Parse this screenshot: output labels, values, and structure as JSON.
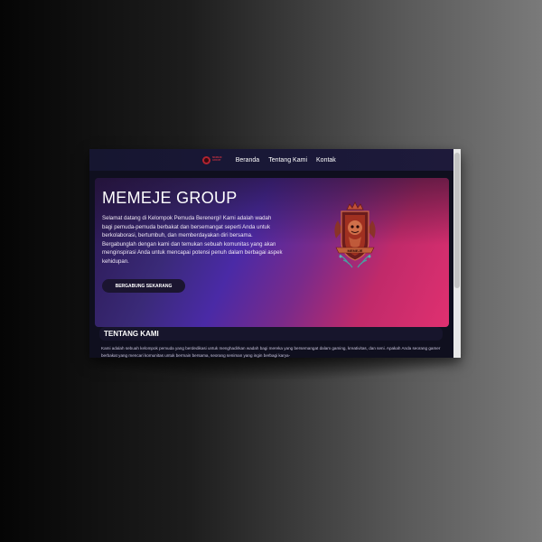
{
  "nav": {
    "logo_line1": "MEMEJE",
    "logo_line2": "GROUP",
    "links": [
      "Beranda",
      "Tentang Kami",
      "Kontak"
    ]
  },
  "hero": {
    "title": "MEMEJE GROUP",
    "description": "Selamat datang di Kelompok Pemuda Berenergi! Kami adalah wadah bagi pemuda-pemuda berbakat dan bersemangat seperti Anda untuk berkolaborasi, bertumbuh, dan memberdayakan diri bersama. Bergabunglah dengan kami dan temukan sebuah komunitas yang akan menginspirasi Anda untuk mencapai potensi penuh dalam berbagai aspek kehidupan.",
    "cta_label": "BERGABUNG SEKARANG",
    "emblem_text": "MEMEJE"
  },
  "about": {
    "heading": "TENTANG KAMI",
    "text": "Kami adalah sebuah kelompok pemuda yang berdedikasi untuk menghadirkan wadah bagi mereka yang bersemangat dalam gaming, kreativitas, dan seni. Apakah Anda seorang gamer berbakat yang mencari komunitas untuk bermain bersama, seorang seniman yang ingin berbagi karya-"
  },
  "colors": {
    "nav_bg": "#161630",
    "hero_start": "#2a1850",
    "hero_end": "#e03070",
    "accent": "#b22330"
  }
}
